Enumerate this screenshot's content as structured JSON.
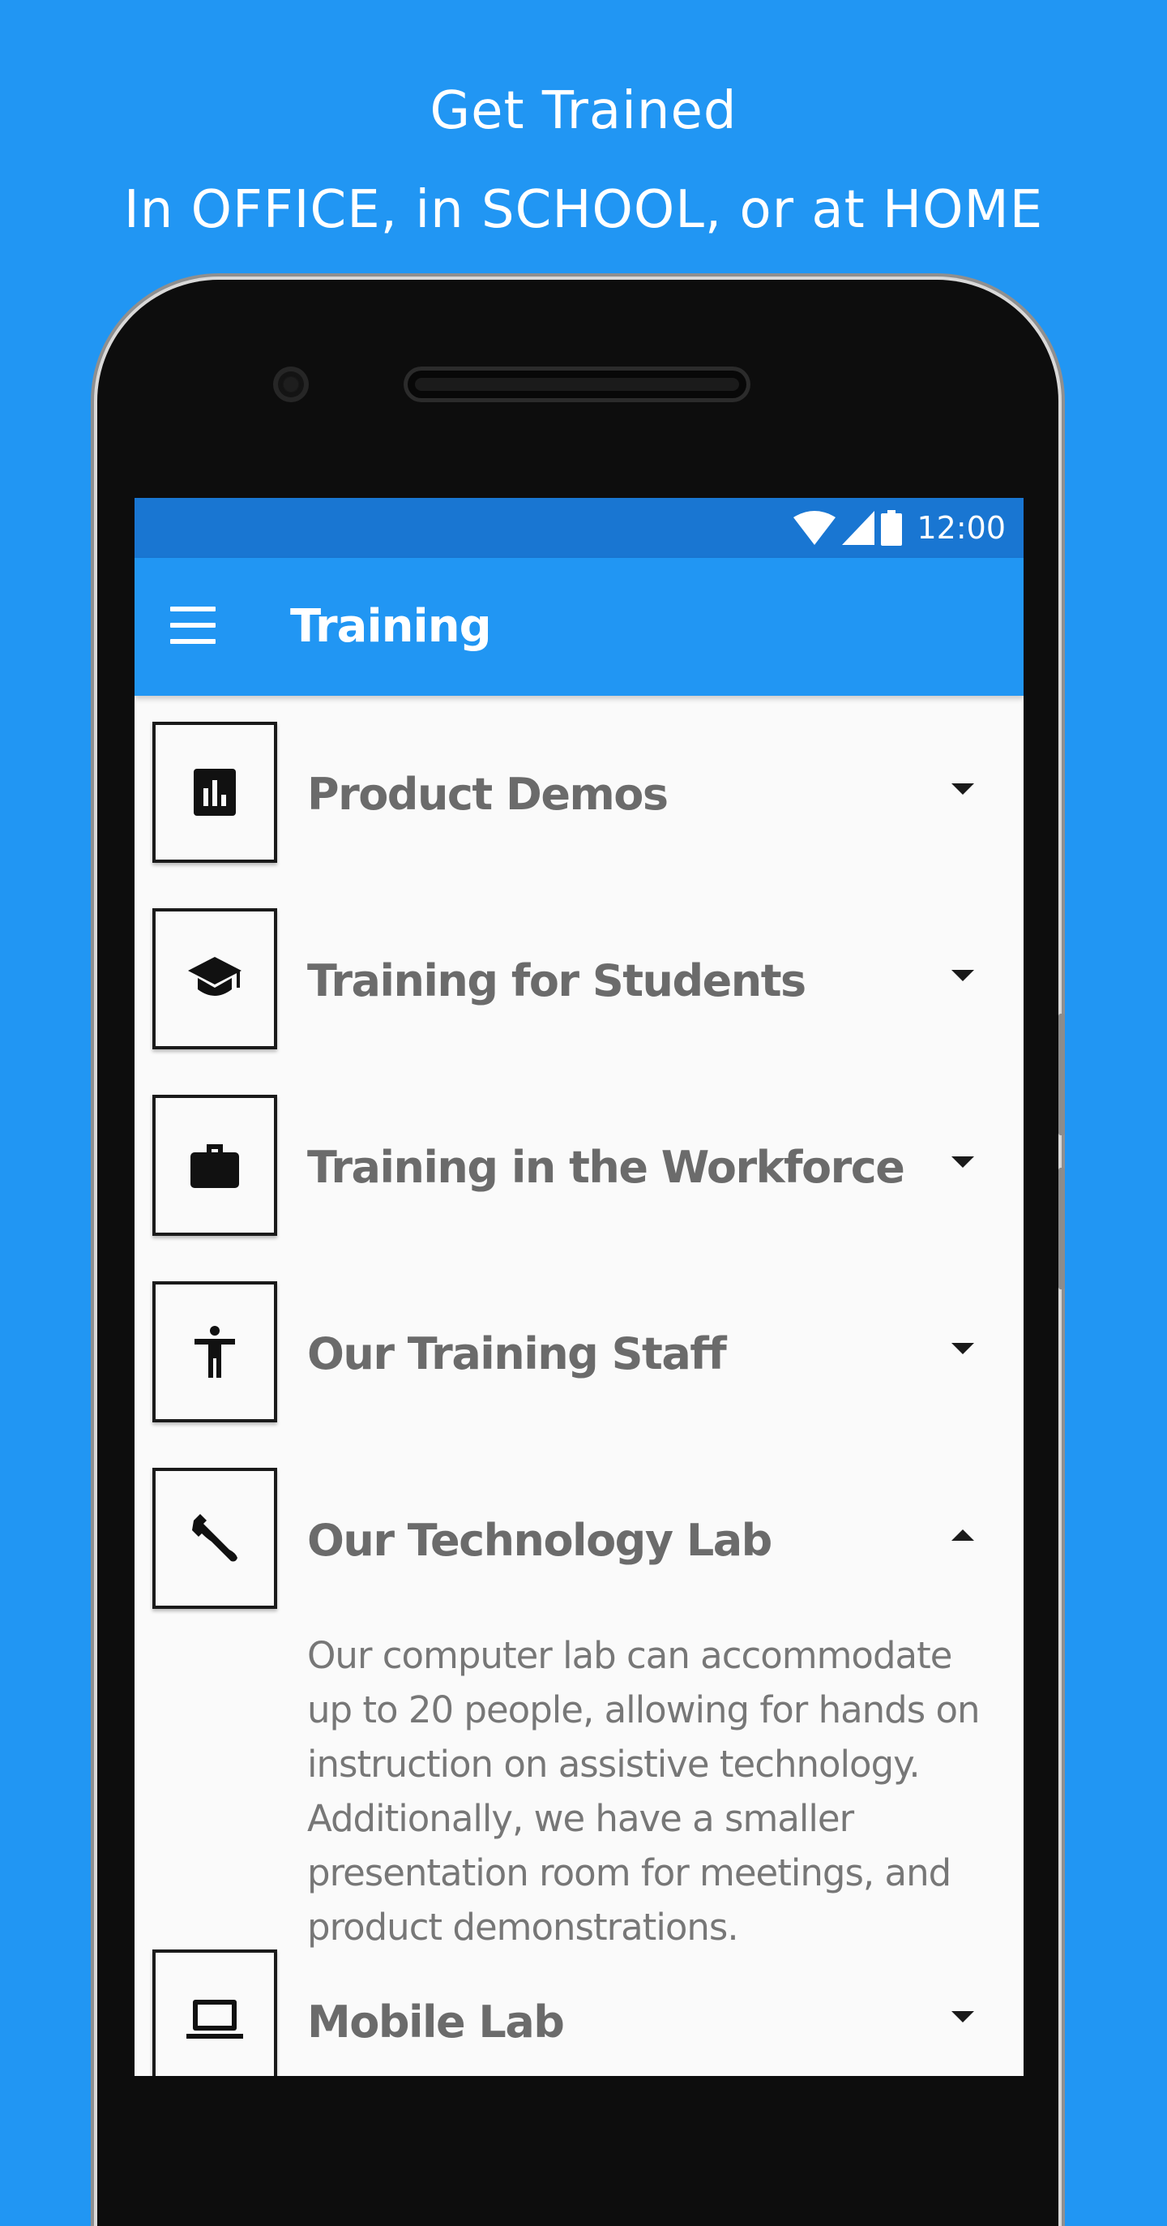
{
  "promo": {
    "headline": "Get Trained",
    "subheadline": "In OFFICE, in SCHOOL, or at HOME"
  },
  "status_bar": {
    "time": "12:00",
    "icons": [
      "wifi-icon",
      "signal-icon",
      "battery-icon"
    ]
  },
  "app_bar": {
    "title": "Training",
    "menu_icon": "menu-icon"
  },
  "training_list": [
    {
      "label": "Product Demos",
      "icon": "bar-chart-icon",
      "expanded": false
    },
    {
      "label": "Training for Students",
      "icon": "graduation-cap-icon",
      "expanded": false
    },
    {
      "label": "Training in the Workforce",
      "icon": "briefcase-icon",
      "expanded": false
    },
    {
      "label": "Our Training Staff",
      "icon": "accessibility-icon",
      "expanded": false
    },
    {
      "label": "Our Technology Lab",
      "icon": "wrench-icon",
      "expanded": true,
      "description": "Our computer lab can accommodate up to 20 people, allowing for hands on instruction on assistive technology. Additionally, we have a smaller presentation room for meetings, and product demonstrations."
    },
    {
      "label": "Mobile Lab",
      "icon": "laptop-icon",
      "expanded": false
    }
  ],
  "colors": {
    "background": "#2196f3",
    "status_bar": "#1976d2",
    "app_bar": "#2196f3",
    "label_text": "#6b6b6b"
  }
}
